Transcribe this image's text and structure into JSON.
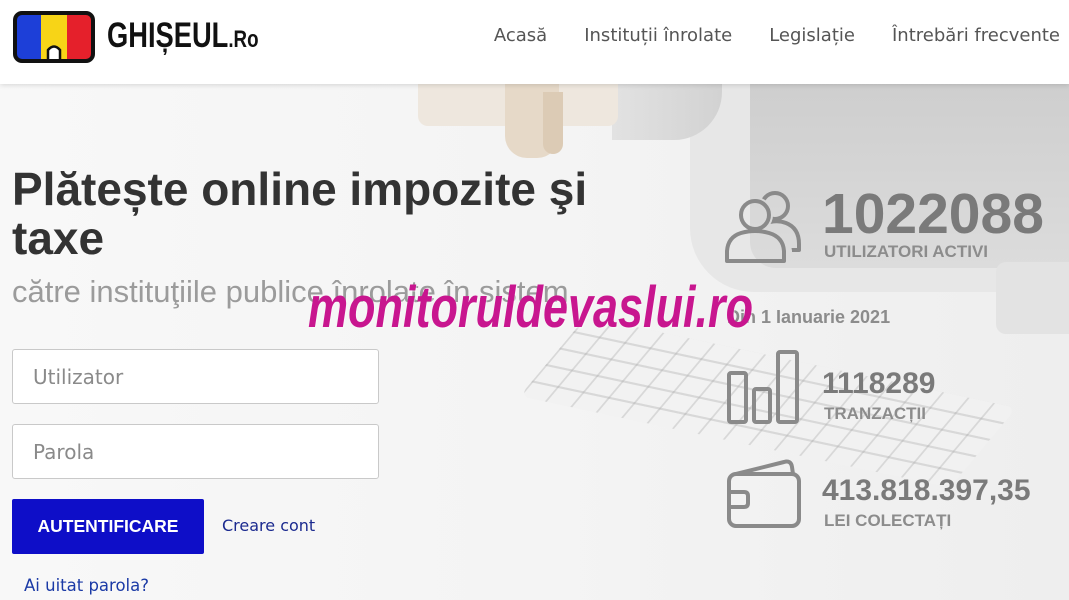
{
  "header": {
    "logo": {
      "name": "GHIȘEUL",
      "suffix": ".Ro",
      "flag_colors": [
        "#1d3fd8",
        "#f7d417",
        "#e5202b"
      ]
    },
    "nav": [
      {
        "label": "Acasă"
      },
      {
        "label": "Instituții înrolate"
      },
      {
        "label": "Legislație"
      },
      {
        "label": "Întrebări frecvente"
      }
    ]
  },
  "hero": {
    "title": "Plătește online impozite şi taxe",
    "subtitle": "către instituţiile publice înrolate în sistem"
  },
  "login": {
    "username": {
      "value": "",
      "placeholder": "Utilizator"
    },
    "password": {
      "value": "",
      "placeholder": "Parola"
    },
    "submit_label": "AUTENTIFICARE",
    "register_link": "Creare cont",
    "forgot_password_link": "Ai uitat parola?"
  },
  "stats": {
    "active_users": {
      "icon": "users-icon",
      "value": "1022088",
      "label": "UTILIZATORI ACTIVI"
    },
    "period": "Din 1 Ianuarie 2021",
    "transactions": {
      "icon": "bar-chart-icon",
      "value": "1118289",
      "label": "TRANZACȚII"
    },
    "collected": {
      "icon": "wallet-icon",
      "value": "413.818.397,35",
      "label": "LEI COLECTAȚI"
    }
  },
  "watermark": {
    "text": "monitoruldevaslui.ro"
  },
  "colors": {
    "primary_button": "#0e0ec8",
    "link": "#1b2a8f",
    "heading": "#333333",
    "stat_text": "#7a7a7a",
    "stat_icon": "#8a8a8a",
    "watermark": "#c8168f"
  }
}
